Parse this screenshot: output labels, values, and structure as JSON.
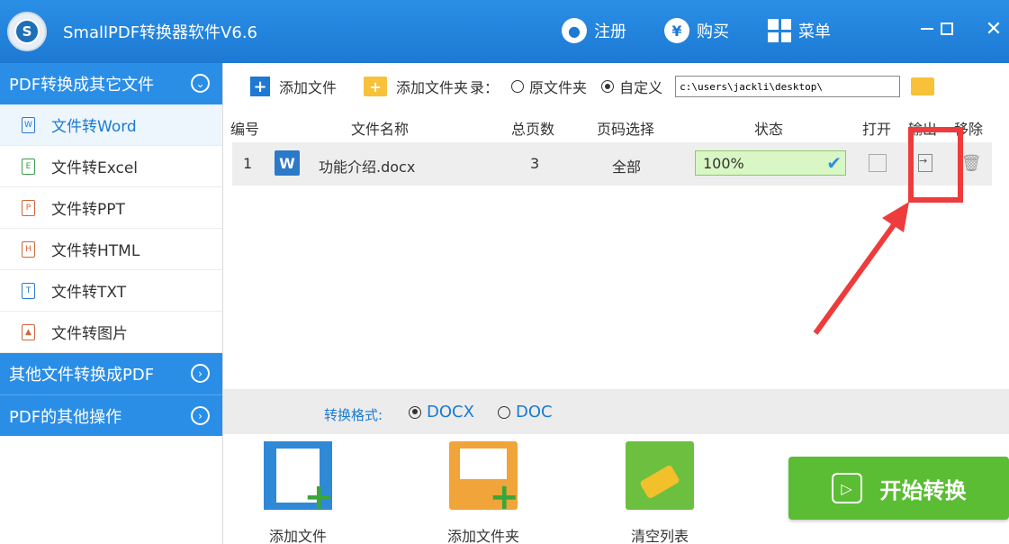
{
  "app": {
    "title": "SmallPDF转换器软件V6.6"
  },
  "titlebar": {
    "register": "注册",
    "buy": "购买",
    "menu": "菜单",
    "close": "✕"
  },
  "sidebar": {
    "cat1": "PDF转换成其它文件",
    "items": [
      {
        "label": "文件转Word",
        "icon": "W"
      },
      {
        "label": "文件转Excel",
        "icon": "E"
      },
      {
        "label": "文件转PPT",
        "icon": "P"
      },
      {
        "label": "文件转HTML",
        "icon": "H"
      },
      {
        "label": "文件转TXT",
        "icon": "T"
      },
      {
        "label": "文件转图片",
        "icon": ""
      }
    ],
    "cat2": "其他文件转换成PDF",
    "cat3": "PDF的其他操作"
  },
  "toolbar": {
    "add_file": "添加文件",
    "add_folder": "添加文件夹",
    "output_label": "录：",
    "opt_original": "原文件夹",
    "opt_custom": "自定义",
    "path": "c:\\users\\jackli\\desktop\\"
  },
  "table": {
    "headers": {
      "num": "编号",
      "name": "文件名称",
      "pages": "总页数",
      "range": "页码选择",
      "status": "状态",
      "open": "打开",
      "output": "输出",
      "remove": "移除"
    },
    "rows": [
      {
        "num": "1",
        "icon": "W",
        "name": "功能介绍.docx",
        "pages": "3",
        "range": "全部",
        "status": "100%",
        "progress": 1.0
      }
    ]
  },
  "format": {
    "label": "转换格式:",
    "opt_docx": "DOCX",
    "opt_doc": "DOC"
  },
  "bottom": {
    "add_file": "添加文件",
    "add_folder": "添加文件夹",
    "clear": "清空列表",
    "start": "开始转换"
  },
  "colors": {
    "title_bar": "#1d79d3",
    "category": "#2b8ee6",
    "start": "#5bbd34",
    "highlight": "#ee3b3b"
  }
}
